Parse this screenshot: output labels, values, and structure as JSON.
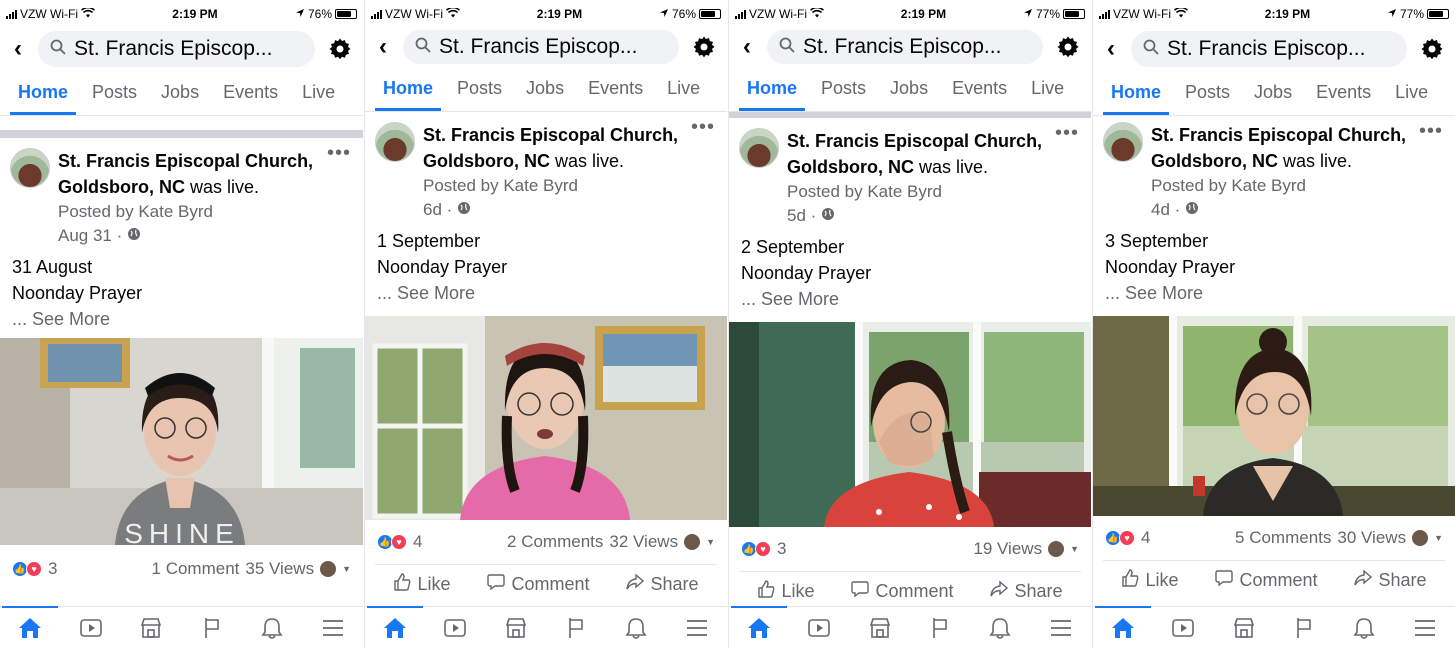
{
  "screens": [
    {
      "status": {
        "carrier": "VZW Wi-Fi",
        "time": "2:19 PM",
        "battery": "76%",
        "battery_level": 0.76
      },
      "search": {
        "value": "St. Francis Episcop..."
      },
      "tabs": [
        "Home",
        "Posts",
        "Jobs",
        "Events",
        "Live"
      ],
      "post": {
        "page_name": "St. Francis Episcopal Church, Goldsboro, NC",
        "was_live": "was live.",
        "posted_by": "Posted by Kate Byrd",
        "time": "Aug 31 ·",
        "line1": "31 August",
        "line2": "Noonday Prayer",
        "see_more": "... See More",
        "reactions_count": "3",
        "comments": "1 Comment",
        "views": "35 Views"
      },
      "actions": null,
      "video": {
        "shirt_text": "SHINE"
      }
    },
    {
      "status": {
        "carrier": "VZW Wi-Fi",
        "time": "2:19 PM",
        "battery": "76%",
        "battery_level": 0.76
      },
      "search": {
        "value": "St. Francis Episcop..."
      },
      "tabs": [
        "Home",
        "Posts",
        "Jobs",
        "Events",
        "Live"
      ],
      "post": {
        "page_name": "St. Francis Episcopal Church, Goldsboro, NC",
        "was_live": "was live.",
        "posted_by": "Posted by Kate Byrd",
        "time": "6d ·",
        "line1": "1 September",
        "line2": "Noonday Prayer",
        "see_more": "... See More",
        "reactions_count": "4",
        "comments": "2 Comments",
        "views": "32 Views"
      },
      "actions": {
        "like": "Like",
        "comment": "Comment",
        "share": "Share"
      }
    },
    {
      "status": {
        "carrier": "VZW Wi-Fi",
        "time": "2:19 PM",
        "battery": "77%",
        "battery_level": 0.77
      },
      "search": {
        "value": "St. Francis Episcop..."
      },
      "tabs": [
        "Home",
        "Posts",
        "Jobs",
        "Events",
        "Live"
      ],
      "post": {
        "page_name": "St. Francis Episcopal Church, Goldsboro, NC",
        "was_live": "was live.",
        "posted_by": "Posted by Kate Byrd",
        "time": "5d ·",
        "line1": "2 September",
        "line2": "Noonday Prayer",
        "see_more": "... See More",
        "reactions_count": "3",
        "comments": "",
        "views": "19 Views"
      },
      "actions": {
        "like": "Like",
        "comment": "Comment",
        "share": "Share"
      }
    },
    {
      "status": {
        "carrier": "VZW Wi-Fi",
        "time": "2:19 PM",
        "battery": "77%",
        "battery_level": 0.77
      },
      "search": {
        "value": "St. Francis Episcop..."
      },
      "tabs": [
        "Home",
        "Posts",
        "Jobs",
        "Events",
        "Live"
      ],
      "post": {
        "page_name": "St. Francis Episcopal Church, Goldsboro, NC",
        "was_live": "was live.",
        "posted_by": "Posted by Kate Byrd",
        "time": "4d ·",
        "line1": "3 September",
        "line2": "Noonday Prayer",
        "see_more": "... See More",
        "reactions_count": "4",
        "comments": "5 Comments",
        "views": "30 Views"
      },
      "actions": {
        "like": "Like",
        "comment": "Comment",
        "share": "Share"
      }
    }
  ],
  "bottom_nav_icons": [
    "home-icon",
    "watch-icon",
    "marketplace-icon",
    "pages-flag-icon",
    "notifications-bell-icon",
    "menu-icon"
  ],
  "colors": {
    "accent": "#1877f2",
    "love": "#f33e58",
    "secondary_text": "#65676b"
  }
}
